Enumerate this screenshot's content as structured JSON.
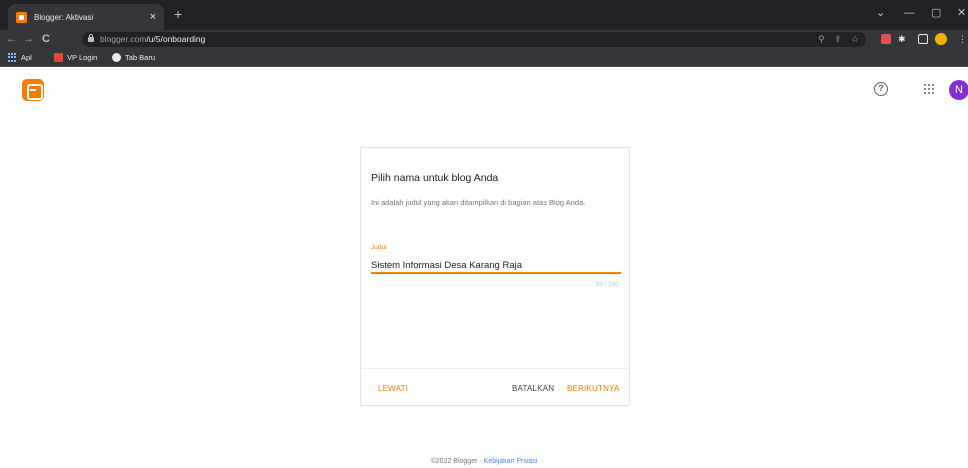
{
  "browser": {
    "tab_title": "Blogger: Aktivasi",
    "tab_close": "×",
    "new_tab": "+",
    "url_host": "blogger.com",
    "url_path": "/u/5/onboarding",
    "window_controls": [
      "⌄",
      "—",
      "▢",
      "✕"
    ],
    "nav_icons": [
      "←",
      "→",
      "C"
    ],
    "bookmarks": [
      {
        "label": "Apl",
        "icon": "apps-grid-icon"
      },
      {
        "label": "VP Login",
        "icon": "folder-icon"
      },
      {
        "label": "Tab Baru",
        "icon": "plus-circle-icon"
      }
    ]
  },
  "appbar": {
    "help_glyph": "?",
    "avatar_letter": "N",
    "colors": {
      "brand": "#f57d00",
      "avatar": "#8430ce"
    }
  },
  "card": {
    "title": "Pilih nama untuk blog Anda",
    "description": "Ini adalah judul yang akan ditampilkan di bagian atas Blog Anda.",
    "field_label": "Judul",
    "field_value": "Sistem Informasi Desa Karang Raja",
    "counter": "33 / 100",
    "skip_label": "LEWATI",
    "cancel_label": "BATALKAN",
    "next_label": "BERIKUTNYA"
  },
  "footer": {
    "copyright": "©2022 Blogger",
    "separator": " · ",
    "privacy_link": "Kebijakan Privasi"
  }
}
